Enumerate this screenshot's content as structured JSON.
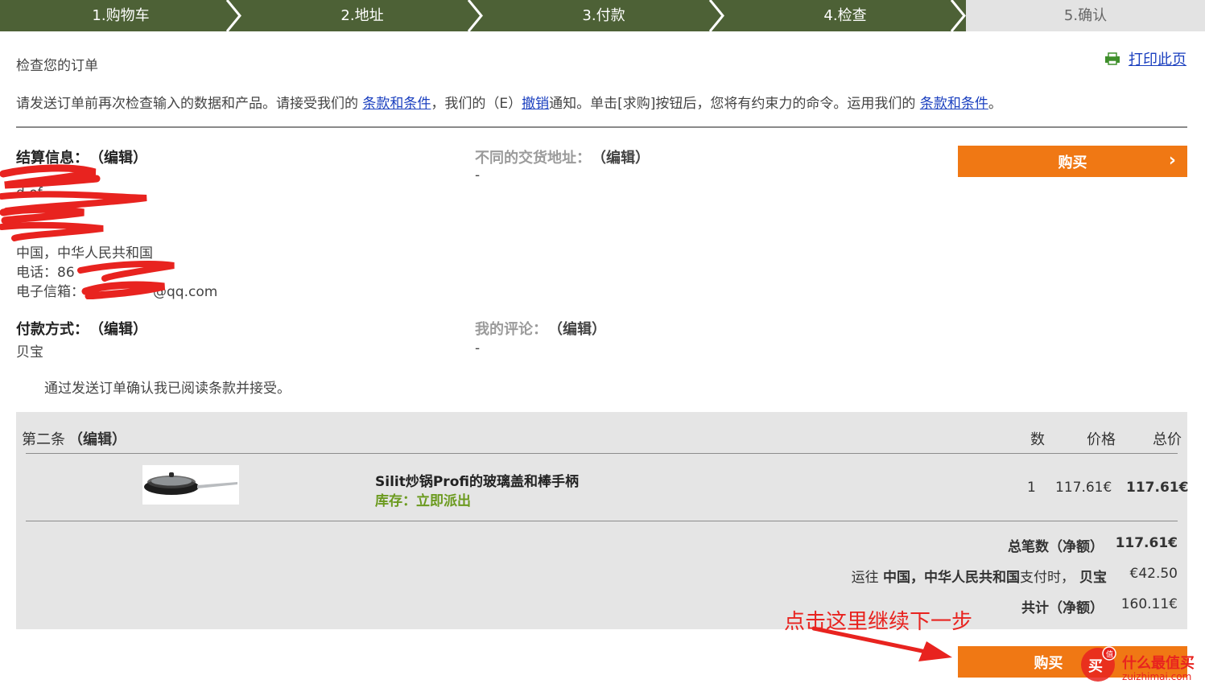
{
  "steps": [
    {
      "label": "1.购物车"
    },
    {
      "label": "2.地址"
    },
    {
      "label": "3.付款"
    },
    {
      "label": "4.检查"
    },
    {
      "label": "5.确认"
    }
  ],
  "page": {
    "title": "检查您的订单",
    "print_label": "打印此页",
    "intro": {
      "t1": "请发送订单前再次检查输入的数据和产品。请接受我们的 ",
      "l1": "条款和条件",
      "t2": "，我们的（E）",
      "l2": "撤销",
      "t3": "通知。单击[求购]按钮后，您将有约束力的命令。运用我们的 ",
      "l3": "条款和条件",
      "t4": "。"
    }
  },
  "billing": {
    "title": "结算信息：",
    "edit": "（编辑）",
    "country": "中国，中华人民共和国",
    "phone": "电话：86",
    "email_suffix": "@qq.com",
    "email_label": "电子信箱：",
    "fragment": "d  of"
  },
  "delivery": {
    "title": "不同的交货地址：",
    "edit": "（编辑）",
    "value": "-"
  },
  "payment": {
    "title": "付款方式：",
    "edit": "（编辑）",
    "value": "贝宝"
  },
  "comment": {
    "title": "我的评论：",
    "edit": "（编辑）",
    "value": "-"
  },
  "confirm_text": "通过发送订单确认我已阅读条款并接受。",
  "buy_label": "购买",
  "cart": {
    "header_label": "第二条",
    "header_edit": "（编辑）",
    "col_qty": "数",
    "col_price": "价格",
    "col_total": "总价",
    "item": {
      "name": "Silit炒锅Profi的玻璃盖和棒手柄",
      "stock": "库存：立即派出",
      "qty": "1",
      "price": "117.61€",
      "total": "117.61€"
    },
    "subtotal_label": "总笔数（净额）",
    "subtotal_value": "117.61€",
    "shipping_pre": "运往 ",
    "shipping_country": "中国，中华人民共和国",
    "shipping_mid": "支付时，",
    "shipping_method": "贝宝",
    "shipping_value": "€42.50",
    "grand_label": "共计（净额）",
    "grand_value": "160.11€"
  },
  "annotation": "点击这里继续下一步",
  "watermark": {
    "text": "什么最值买",
    "domain": "zuizhimai.com",
    "badge": "买",
    "mini": "值"
  },
  "colors": {
    "step_done": "#4d6136",
    "buy": "#f07814",
    "annotation": "#e8231f",
    "link": "#1a3fbf",
    "stock": "#6b9a1e"
  }
}
